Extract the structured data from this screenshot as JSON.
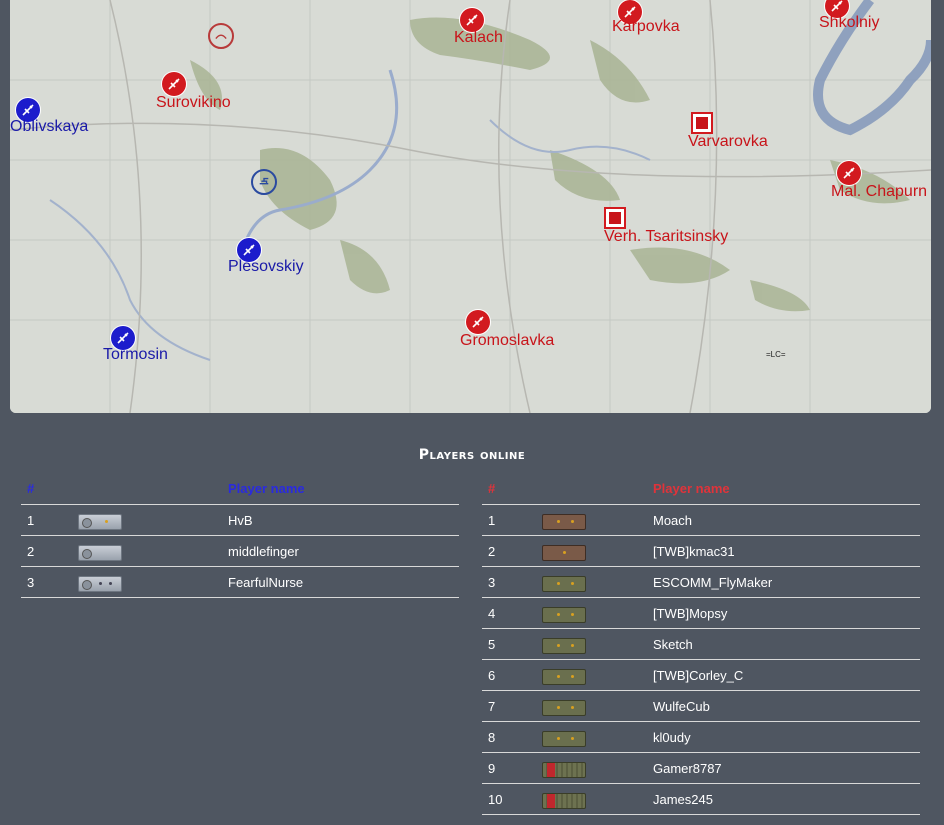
{
  "map": {
    "markers": [
      {
        "name": "Oblivskaya",
        "side": "blue",
        "type": "airfield"
      },
      {
        "name": "Surovikino",
        "side": "red",
        "type": "airfield"
      },
      {
        "name": "Kalach",
        "side": "red",
        "type": "airfield"
      },
      {
        "name": "Karpovka",
        "side": "red",
        "type": "airfield"
      },
      {
        "name": "Shkolniy",
        "side": "red",
        "type": "airfield"
      },
      {
        "name": "Varvarovka",
        "side": "red",
        "type": "factory"
      },
      {
        "name": "Mal. Chapurn",
        "side": "red",
        "type": "airfield"
      },
      {
        "name": "Verh. Tsaritsinsky",
        "side": "red",
        "type": "factory"
      },
      {
        "name": "Plesovskiy",
        "side": "blue",
        "type": "airfield"
      },
      {
        "name": "Tormosin",
        "side": "blue",
        "type": "airfield"
      },
      {
        "name": "Gromoslavka",
        "side": "red",
        "type": "airfield"
      }
    ],
    "map_note": "=LC="
  },
  "players": {
    "title": "Players online",
    "left": {
      "col_num": "#",
      "col_name": "Player name",
      "rows": [
        {
          "num": "1",
          "name": "HvB"
        },
        {
          "num": "2",
          "name": "middlefinger"
        },
        {
          "num": "3",
          "name": "FearfulNurse"
        }
      ]
    },
    "right": {
      "col_num": "#",
      "col_name": "Player name",
      "rows": [
        {
          "num": "1",
          "name": "Moach"
        },
        {
          "num": "2",
          "name": "[TWB]kmac31"
        },
        {
          "num": "3",
          "name": "ESCOMM_FlyMaker"
        },
        {
          "num": "4",
          "name": "[TWB]Mopsy"
        },
        {
          "num": "5",
          "name": "Sketch"
        },
        {
          "num": "6",
          "name": "[TWB]Corley_C"
        },
        {
          "num": "7",
          "name": "WulfeCub"
        },
        {
          "num": "8",
          "name": "kl0udy"
        },
        {
          "num": "9",
          "name": "Gamer8787"
        },
        {
          "num": "10",
          "name": "James245"
        }
      ]
    }
  },
  "colors": {
    "background": "#4f5661",
    "red_side": "#c8141a",
    "blue_side": "#1a1aa8",
    "left_header": "#2a2ae0",
    "right_header": "#e0333a"
  }
}
